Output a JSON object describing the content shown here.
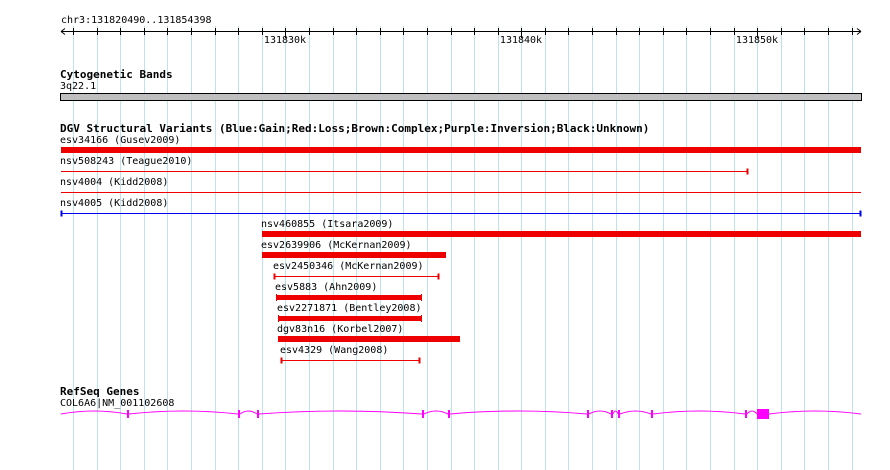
{
  "ruler": {
    "region": "chr3:131820490..131854398",
    "start": 131820490,
    "end": 131854398,
    "ticks": [
      {
        "pos": 131830000,
        "label": "131830k"
      },
      {
        "pos": 131840000,
        "label": "131840k"
      },
      {
        "pos": 131850000,
        "label": "131850k"
      }
    ]
  },
  "cytoband": {
    "title": "Cytogenetic Bands",
    "label": "3q22.1",
    "color": "#bfbfbf"
  },
  "dgv": {
    "title": "DGV Structural Variants (Blue:Gain;Red:Loss;Brown:Complex;Purple:Inversion;Black:Unknown)",
    "colors": {
      "loss": "#ee0000",
      "gain": "#0000ee"
    },
    "features": [
      {
        "label": "esv34166 (Gusev2009)",
        "start": 131820490,
        "end": 131854398,
        "style": "bar",
        "type": "loss"
      },
      {
        "label": "nsv508243 (Teague2010)",
        "start": 131820490,
        "end": 131849600,
        "style": "line",
        "type": "loss",
        "cap_left": false,
        "cap_right": true
      },
      {
        "label": "nsv4004 (Kidd2008)",
        "start": 131820490,
        "end": 131854398,
        "style": "line",
        "type": "loss",
        "cap_left": false,
        "cap_right": false
      },
      {
        "label": "nsv4005 (Kidd2008)",
        "start": 131820490,
        "end": 131854398,
        "style": "line",
        "type": "gain",
        "cap_left": true,
        "cap_right": true
      },
      {
        "label": "nsv460855 (Itsara2009)",
        "start": 131829000,
        "end": 131854398,
        "style": "bar",
        "type": "loss"
      },
      {
        "label": "esv2639906 (McKernan2009)",
        "start": 131829000,
        "end": 131836800,
        "style": "bar",
        "type": "loss"
      },
      {
        "label": "esv2450346 (McKernan2009)",
        "start": 131829500,
        "end": 131836500,
        "style": "line",
        "type": "loss",
        "cap_left": true,
        "cap_right": true
      },
      {
        "label": "esv5883 (Ahn2009)",
        "start": 131829600,
        "end": 131835800,
        "style": "capbar",
        "type": "loss"
      },
      {
        "label": "esv2271871 (Bentley2008)",
        "start": 131829700,
        "end": 131835800,
        "style": "capbar",
        "type": "loss"
      },
      {
        "label": "dgv83n16 (Korbel2007)",
        "start": 131829700,
        "end": 131837400,
        "style": "bar",
        "type": "loss"
      },
      {
        "label": "esv4329 (Wang2008)",
        "start": 131829800,
        "end": 131835700,
        "style": "line",
        "type": "loss",
        "cap_left": true,
        "cap_right": true
      }
    ]
  },
  "refseq": {
    "title": "RefSeq Genes",
    "label": "COL6A6|NM_001102608",
    "color": "#ff00ff",
    "exons": [
      {
        "start": 131823300,
        "end": 131823380
      },
      {
        "start": 131828000,
        "end": 131828080
      },
      {
        "start": 131828800,
        "end": 131828880
      },
      {
        "start": 131835800,
        "end": 131835880
      },
      {
        "start": 131836900,
        "end": 131836980
      },
      {
        "start": 131842800,
        "end": 131842880
      },
      {
        "start": 131843800,
        "end": 131843880
      },
      {
        "start": 131844100,
        "end": 131844180
      },
      {
        "start": 131845500,
        "end": 131845580
      },
      {
        "start": 131849500,
        "end": 131849580
      },
      {
        "start": 131850000,
        "end": 131850500
      }
    ]
  }
}
